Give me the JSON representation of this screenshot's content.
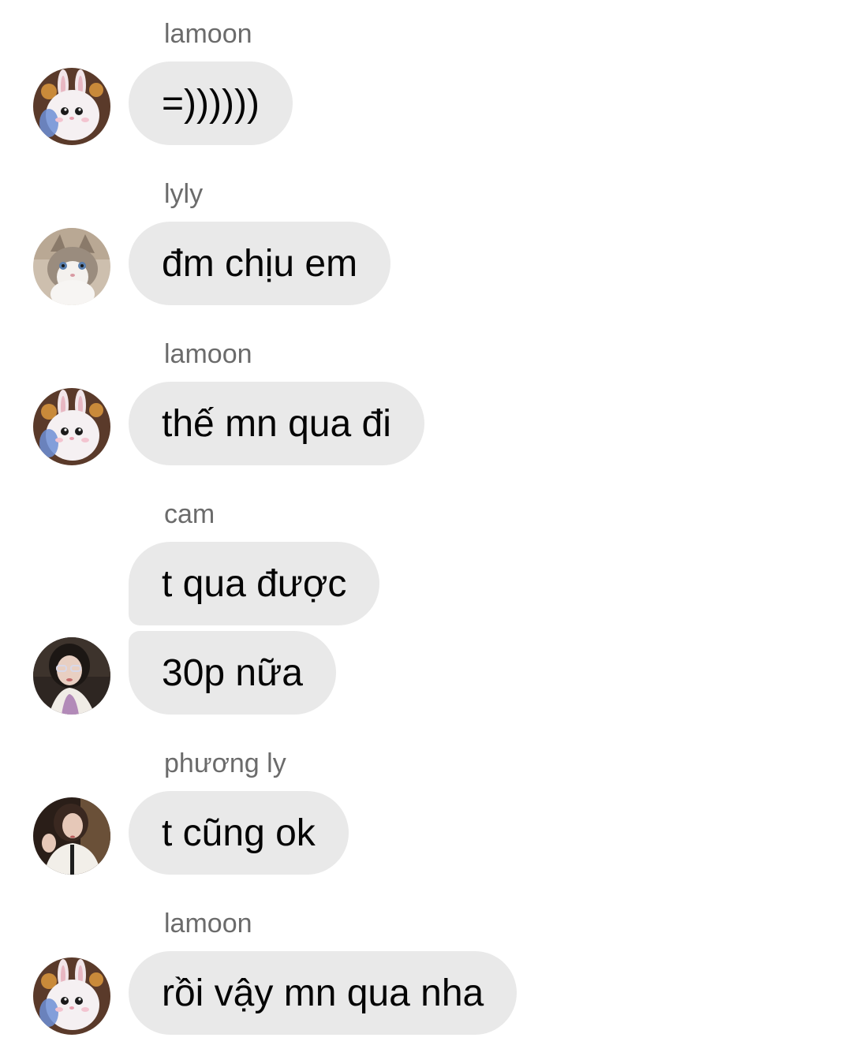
{
  "messages": [
    {
      "sender": "lamoon",
      "avatar": "bunny-avatar",
      "texts": [
        "=))))))"
      ]
    },
    {
      "sender": "lyly",
      "avatar": "cat-avatar",
      "texts": [
        "đm chịu em"
      ]
    },
    {
      "sender": "lamoon",
      "avatar": "bunny-avatar",
      "texts": [
        "thế mn qua đi"
      ]
    },
    {
      "sender": "cam",
      "avatar": "girl-avatar",
      "texts": [
        "t qua được",
        "30p nữa"
      ]
    },
    {
      "sender": "phương ly",
      "avatar": "girl-avatar",
      "texts": [
        "t cũng ok"
      ]
    },
    {
      "sender": "lamoon",
      "avatar": "bunny-avatar",
      "texts": [
        "rồi vậy mn qua nha"
      ]
    }
  ],
  "colors": {
    "bubble": "#e9e9e9",
    "sender_name": "#6b6b6b",
    "message_text": "#050505",
    "background": "#ffffff"
  }
}
